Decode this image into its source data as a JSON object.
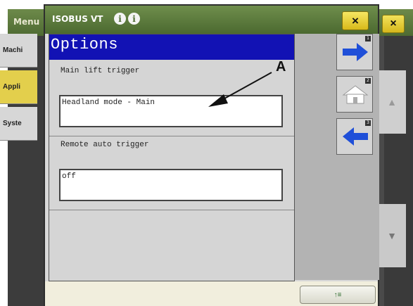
{
  "background_window": {
    "title": "Menu",
    "close_label": "×",
    "nav_items": [
      {
        "label": "Machi"
      },
      {
        "label": "Appli"
      },
      {
        "label": "Syste"
      }
    ],
    "scroll_up_icon": "chevron-up-icon",
    "scroll_down_icon": "chevron-down-icon"
  },
  "vt_window": {
    "title": "ISOBUS VT",
    "info_icons": [
      "i",
      "i"
    ],
    "close_label": "×",
    "mask": {
      "header": "Options",
      "fields": [
        {
          "label": "Main lift trigger",
          "value": "Headland mode - Main"
        },
        {
          "label": "Remote auto trigger",
          "value": "off"
        }
      ]
    },
    "softkeys": [
      {
        "icon": "arrow-right-icon",
        "number": "1"
      },
      {
        "icon": "home-icon",
        "number": "2"
      },
      {
        "icon": "arrow-left-icon",
        "number": "3"
      }
    ],
    "bottom_button": {
      "label": "↑≡",
      "icon": "softkey-toggle-icon"
    }
  },
  "annotation": {
    "letter": "A"
  },
  "colors": {
    "title_bar_green": "#5b7a3d",
    "mask_header_blue": "#1212b4",
    "close_yellow": "#e6cc33",
    "softkey_arrow_blue": "#1f4fd8"
  }
}
